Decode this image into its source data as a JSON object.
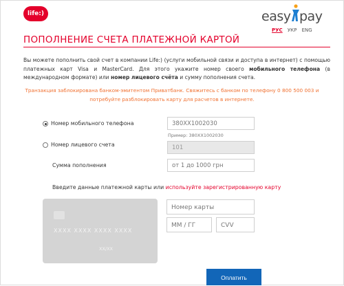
{
  "header": {
    "life_logo_text": "life:)",
    "easypay_logo": {
      "left": "easy",
      "right": "pay"
    },
    "languages": [
      {
        "label": "РУС",
        "active": true
      },
      {
        "label": "УКР",
        "active": false
      },
      {
        "label": "ENG",
        "active": false
      }
    ]
  },
  "page": {
    "title": "ПОПОЛНЕНИЕ СЧЕТА ПЛАТЕЖНОЙ КАРТОЙ",
    "intro_part1": "Вы можете пополнить свой счет в компании Life:) (услуги мобильной связи и доступа в интернет) с помощью платежных карт Visa и MasterCard. Для этого укажите номер своего ",
    "intro_bold1": "мобильного телефона",
    "intro_part2": " (в международном формате) или ",
    "intro_bold2": "номер лицевого счёта",
    "intro_part3": " и сумму пополнения счета.",
    "warning": "Транзакция заблокирована банком-эмитентом Приватбанк. Свяжитесь с банком по телефону 0 800 500 003 и потребуйте разблокировать карту для расчетов в интернете."
  },
  "form": {
    "phone_label": "Номер мобильного телефона",
    "phone_value": "380XX1002030",
    "phone_hint": "Пример: 380XX1002030",
    "account_label": "Номер лицевого счета",
    "account_value": "101",
    "amount_label": "Сумма пополнения",
    "amount_placeholder": "от 1 до 1000 грн",
    "selected_option": "phone"
  },
  "card": {
    "prompt_text": "Введите данные платежной карты или ",
    "prompt_link": "используйте зарегистрированную карту",
    "image_number": "XXXX XXXX XXXX XXXX",
    "image_expiry": "XX/XX",
    "number_placeholder": "Номер карты",
    "expiry_placeholder": "ММ / ГГ",
    "cvv_placeholder": "CVV"
  },
  "actions": {
    "pay_label": "Оплатить"
  },
  "colors": {
    "brand": "#e4002b",
    "warning": "#f07030",
    "button": "#1266b8",
    "card": "#d4d4d4"
  }
}
